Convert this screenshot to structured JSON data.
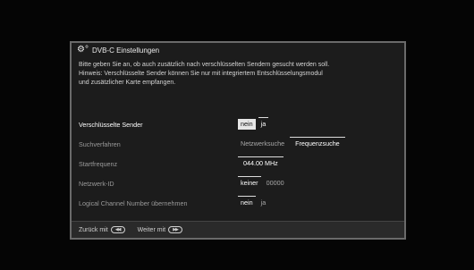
{
  "dialog": {
    "title": "DVB-C Einstellungen",
    "icon": "settings-gears-icon",
    "description": [
      "Bitte geben Sie an, ob auch zusätzlich nach verschlüsselten Sendern gesucht werden soll.",
      "Hinweis: Verschlüsselte Sender können Sie nur mit integriertem Entschlüsselungsmodul",
      "und zusätzlicher Karte empfangen."
    ]
  },
  "rows": [
    {
      "label": "Verschlüsselte Sender",
      "options": [
        "nein",
        "ja"
      ]
    },
    {
      "label": "Suchverfahren",
      "options": [
        "Netzwerksuche",
        "Frequenzsuche"
      ]
    },
    {
      "label": "Startfrequenz",
      "value": "044.00 MHz"
    },
    {
      "label": "Netzwerk-ID",
      "options": [
        "keiner",
        "00000"
      ]
    },
    {
      "label": "Logical Channel Number übernehmen",
      "options": [
        "nein",
        "ja"
      ]
    }
  ],
  "footer": {
    "back_label": "Zurück mit",
    "back_icon": "rewind-button-icon",
    "next_label": "Weiter mit",
    "next_icon": "fast-forward-button-icon"
  },
  "colors": {
    "background": "#050505",
    "dialog_bg": "#1c1c1c",
    "highlight": "#e6e6e6"
  }
}
